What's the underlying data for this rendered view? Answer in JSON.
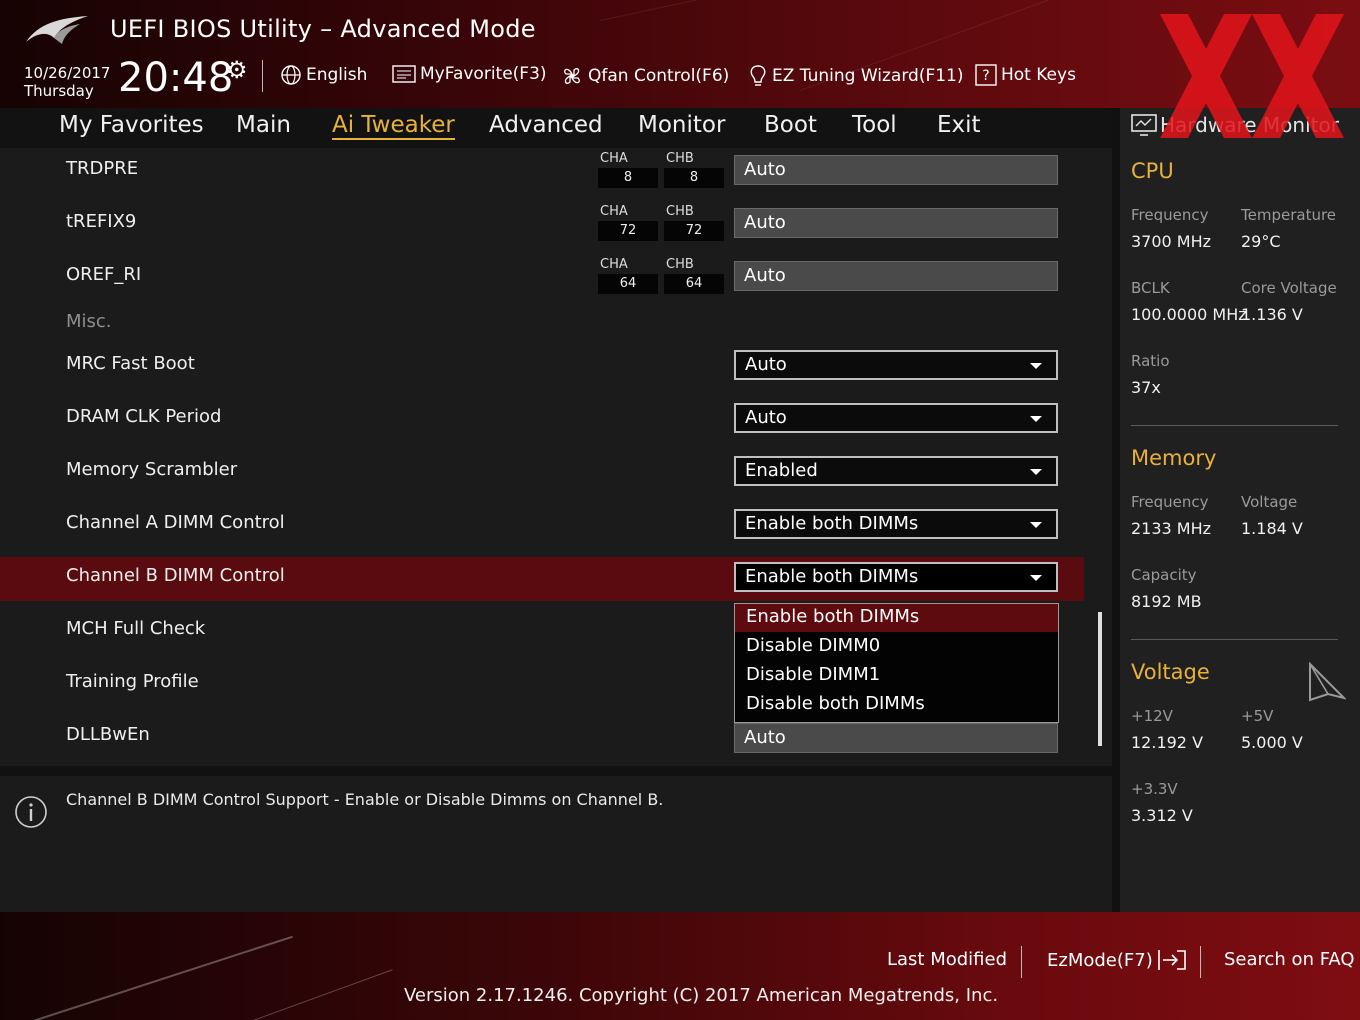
{
  "header": {
    "title": "UEFI BIOS Utility – Advanced Mode",
    "date": "10/26/2017",
    "day": "Thursday",
    "time": "20:48",
    "tools": [
      {
        "label": "English",
        "icon": "globe-icon"
      },
      {
        "label": "MyFavorite(F3)",
        "icon": "favorite-icon"
      },
      {
        "label": "Qfan Control(F6)",
        "icon": "fan-icon"
      },
      {
        "label": "EZ Tuning Wizard(F11)",
        "icon": "lightbulb-icon"
      },
      {
        "label": "Hot Keys",
        "icon": "help-key-icon"
      }
    ]
  },
  "nav": {
    "tabs": [
      "My Favorites",
      "Main",
      "Ai Tweaker",
      "Advanced",
      "Monitor",
      "Boot",
      "Tool",
      "Exit"
    ],
    "active": "Ai Tweaker"
  },
  "settings": {
    "rows": [
      {
        "label": "TRDPRE",
        "cha_label": "CHA",
        "cha": "8",
        "chb_label": "CHB",
        "chb": "8",
        "value": "Auto",
        "type": "text"
      },
      {
        "label": "tREFIX9",
        "cha_label": "CHA",
        "cha": "72",
        "chb_label": "CHB",
        "chb": "72",
        "value": "Auto",
        "type": "text"
      },
      {
        "label": "OREF_RI",
        "cha_label": "CHA",
        "cha": "64",
        "chb_label": "CHB",
        "chb": "64",
        "value": "Auto",
        "type": "text"
      },
      {
        "label": "Misc.",
        "type": "section"
      },
      {
        "label": "MRC Fast Boot",
        "value": "Auto",
        "type": "select"
      },
      {
        "label": "DRAM CLK Period",
        "value": "Auto",
        "type": "select"
      },
      {
        "label": "Memory Scrambler",
        "value": "Enabled",
        "type": "select"
      },
      {
        "label": "Channel A DIMM Control",
        "value": "Enable both DIMMs",
        "type": "select"
      },
      {
        "label": "Channel B DIMM Control",
        "value": "Enable both DIMMs",
        "type": "select"
      },
      {
        "label": "MCH Full Check"
      },
      {
        "label": "Training Profile"
      },
      {
        "label": "DLLBwEn",
        "value": "Auto",
        "type": "text"
      }
    ],
    "dropdown_options": [
      "Enable both DIMMs",
      "Disable DIMM0",
      "Disable DIMM1",
      "Disable both DIMMs"
    ],
    "dropdown_selected": "Enable both DIMMs"
  },
  "help": {
    "text": "Channel B DIMM Control Support - Enable or Disable Dimms on Channel B."
  },
  "hardware_monitor": {
    "title": "Hardware Monitor",
    "cpu": {
      "heading": "CPU",
      "frequency_label": "Frequency",
      "frequency": "3700 MHz",
      "temperature_label": "Temperature",
      "temperature": "29°C",
      "bclk_label": "BCLK",
      "bclk": "100.0000 MHz",
      "core_voltage_label": "Core Voltage",
      "core_voltage": "1.136 V",
      "ratio_label": "Ratio",
      "ratio": "37x"
    },
    "memory": {
      "heading": "Memory",
      "frequency_label": "Frequency",
      "frequency": "2133 MHz",
      "voltage_label": "Voltage",
      "voltage": "1.184 V",
      "capacity_label": "Capacity",
      "capacity": "8192 MB"
    },
    "voltage": {
      "heading": "Voltage",
      "v12_label": "+12V",
      "v12": "12.192 V",
      "v5_label": "+5V",
      "v5": "5.000 V",
      "v33_label": "+3.3V",
      "v33": "3.312 V"
    }
  },
  "footer": {
    "last_modified": "Last Modified",
    "ezmode": "EzMode(F7)",
    "search": "Search on FAQ",
    "version": "Version 2.17.1246. Copyright (C) 2017 American Megatrends, Inc."
  },
  "colors": {
    "accent": "#e8b13a",
    "highlight": "#5a0b0f",
    "header_red": "#7a0d12",
    "watermark": "#e3141b"
  }
}
